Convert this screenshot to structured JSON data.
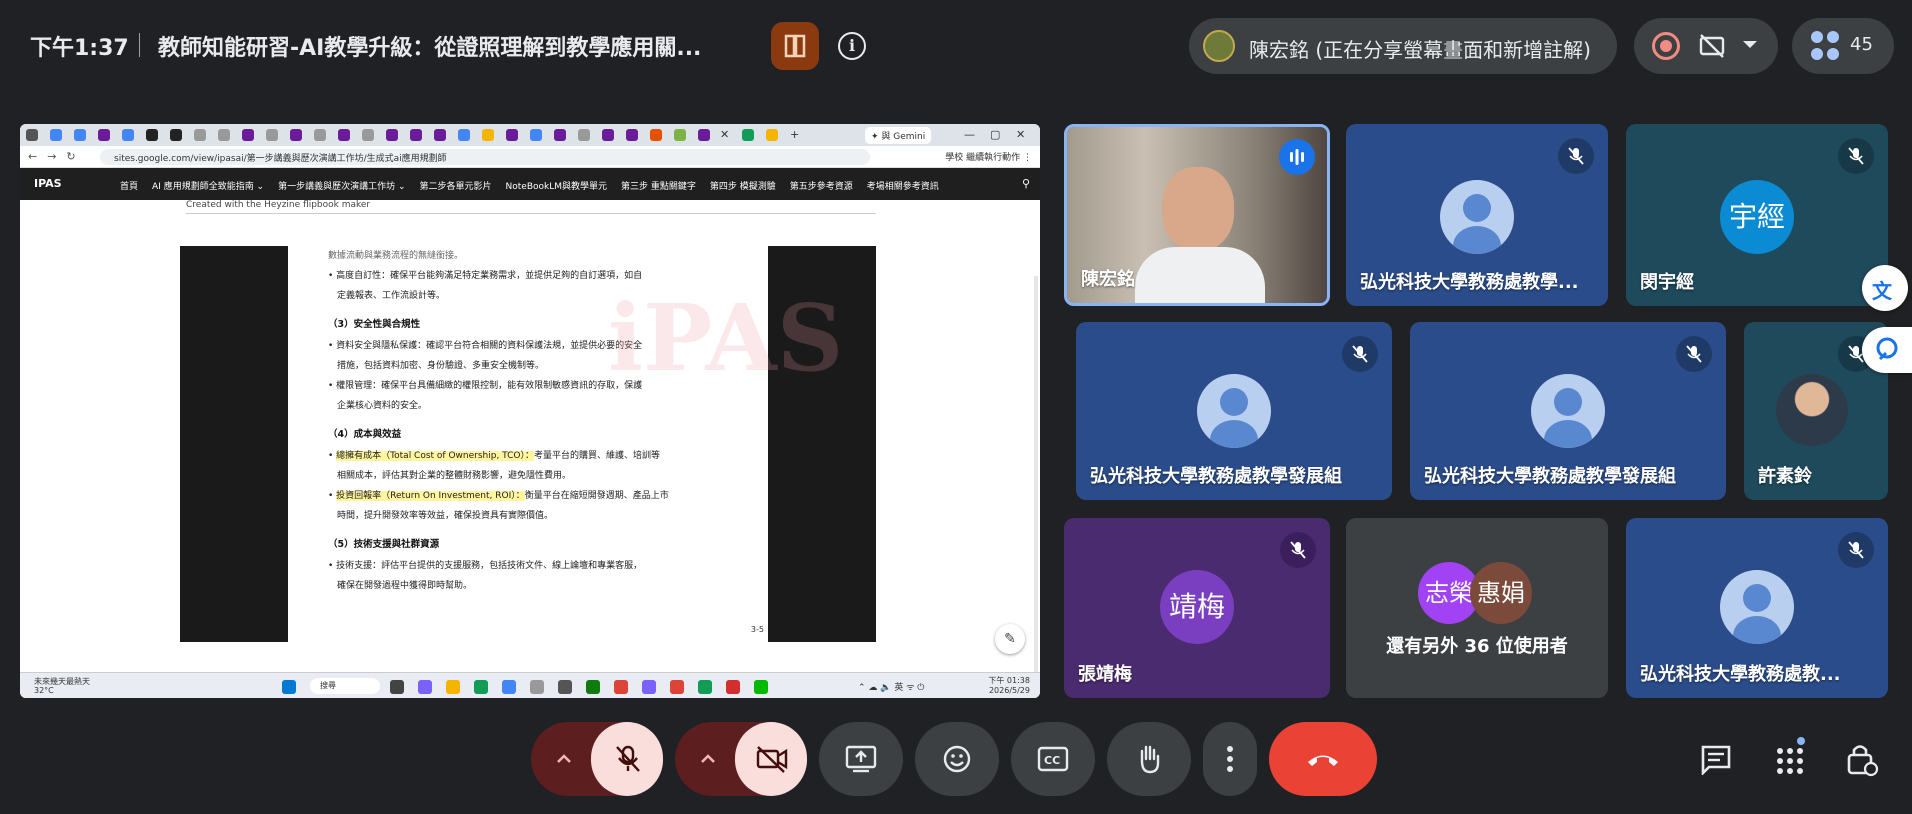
{
  "header": {
    "time": "下午1:37",
    "meeting_title": "教師知能研習-AI教學升級：從證照理解到教學應用關...",
    "presenter_text": "陳宏銘 (正在分享螢幕畫面和新增註解)",
    "participant_count": "45"
  },
  "shared_screen": {
    "gemini_tab": "✦ 與 Gemini",
    "url": "sites.google.com/view/ipasai/第一步講義與歷次演講工作坊/生成式ai應用規劃師",
    "addr_right": "學校   繼續執行動作 ⋮",
    "site": {
      "logo": "IPAS",
      "menu": [
        "首頁",
        "AI 應用規劃師全致能指南 ⌄",
        "第一步講義與歷次演講工作坊 ⌄",
        "第二步各單元影片",
        "NoteBookLM與教學單元",
        "第三步 重點關鍵字",
        "第四步 模擬測驗",
        "第五步參考資源",
        "考場相關參考資訊"
      ]
    },
    "flipbook_caption": "Created with the Heyzine flipbook maker",
    "watermark": "iPAS",
    "doc": {
      "line1": "數據流動與業務流程的無縫銜接。",
      "line2a": "• 高度自訂性：確保平台能夠滿足特定業務需求，並提供足夠的自訂選項，如自",
      "line2b": "定義報表、工作流設計等。",
      "head3": "（3）安全性與合規性",
      "line3a": "• 資料安全與隱私保護：確認平台符合相關的資料保護法規，並提供必要的安全",
      "line3b": "措施，包括資料加密、身份驗證、多重安全機制等。",
      "line3c": "• 權限管理：確保平台具備細緻的權限控制，能有效限制敏感資訊的存取，保護",
      "line3d": "企業核心資料的安全。",
      "head4": "（4）成本與效益",
      "line4a_hl": "總擁有成本（Total Cost of Ownership, TCO）：",
      "line4a": "考量平台的購買、維護、培訓等",
      "line4b": "相關成本，評估其對企業的整體財務影響，避免隱性費用。",
      "line4c_hl": "投資回報率（Return On Investment, ROI）：",
      "line4c": "衡量平台在縮短開發週期、產品上市",
      "line4d": "時間，提升開發效率等效益，確保投資具有實際價值。",
      "head5": "（5）技術支援與社群資源",
      "line5a": "• 技術支援：評估平台提供的支援服務，包括技術文件、線上論壇和專業客服，",
      "line5b": "確保在開發過程中獲得即時幫助。",
      "page_number": "3-5"
    },
    "taskbar": {
      "weather": "未來幾天最熱天",
      "temp": "32°C",
      "search": "搜尋",
      "tray": "⌃  ☁  🔈  英  ᯤ  ⏻",
      "time": "下午 01:38",
      "date": "2026/5/29"
    }
  },
  "participants": [
    {
      "name": "陳宏銘"
    },
    {
      "name": "弘光科技大學教務處教學..."
    },
    {
      "name": "閔宇經",
      "initials": "宇經"
    },
    {
      "name": "弘光科技大學教務處教學發展組"
    },
    {
      "name": "弘光科技大學教務處教學發展組"
    },
    {
      "name": "許素鈴"
    },
    {
      "name": "張靖梅",
      "initials": "靖梅"
    },
    {
      "others_text": "還有另外 36 位使用者",
      "initial_a": "志榮",
      "initial_b": "惠娟"
    },
    {
      "name": "弘光科技大學教務處教..."
    }
  ],
  "colors": {
    "background": "#202124",
    "tile_blue": "#2b4c8a",
    "tile_teal": "#1f4a5c",
    "tile_purple": "#4a2b70",
    "end_call": "#ea4335",
    "muted_control": "#f9dedc"
  },
  "icons": [
    "info-icon",
    "record-icon",
    "no-captions-icon",
    "people-icon",
    "mic-off-icon",
    "camera-off-icon",
    "present-icon",
    "emoji-icon",
    "captions-icon",
    "raise-hand-icon",
    "more-icon",
    "end-call-icon",
    "chat-icon",
    "activities-icon",
    "host-controls-icon",
    "translate-icon",
    "gemini-icon"
  ]
}
